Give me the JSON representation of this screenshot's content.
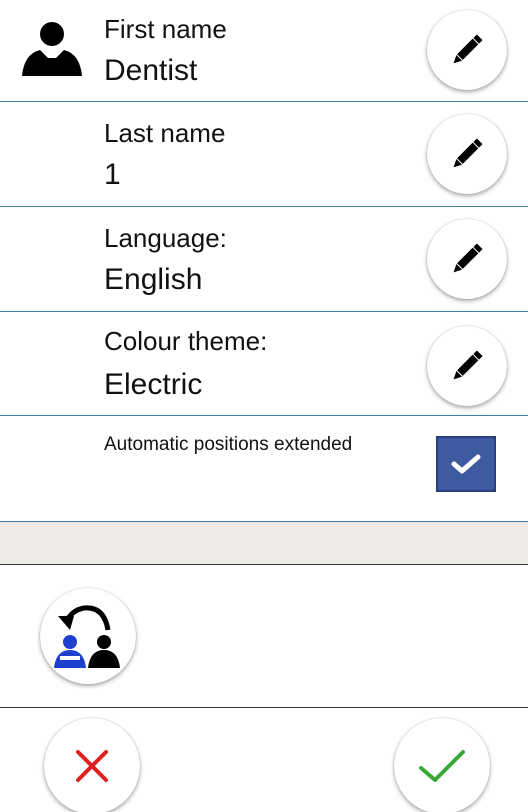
{
  "fields": [
    {
      "label": "First name",
      "value": "Dentist"
    },
    {
      "label": "Last name",
      "value": "1"
    },
    {
      "label": "Language:",
      "value": "English"
    },
    {
      "label": "Colour theme:",
      "value": "Electric"
    }
  ],
  "option": {
    "label": "Automatic positions extended",
    "checked": true
  },
  "icons": {
    "user": "user-icon",
    "edit": "pencil-icon",
    "swap": "swap-user-icon",
    "cancel": "close-icon",
    "confirm": "checkmark-icon"
  },
  "colors": {
    "divider": "#3f7fae",
    "checkbox": "#3e5aa1",
    "cancel": "#e02020",
    "confirm": "#3aa838",
    "swap_badge": "#1f3fcf"
  }
}
